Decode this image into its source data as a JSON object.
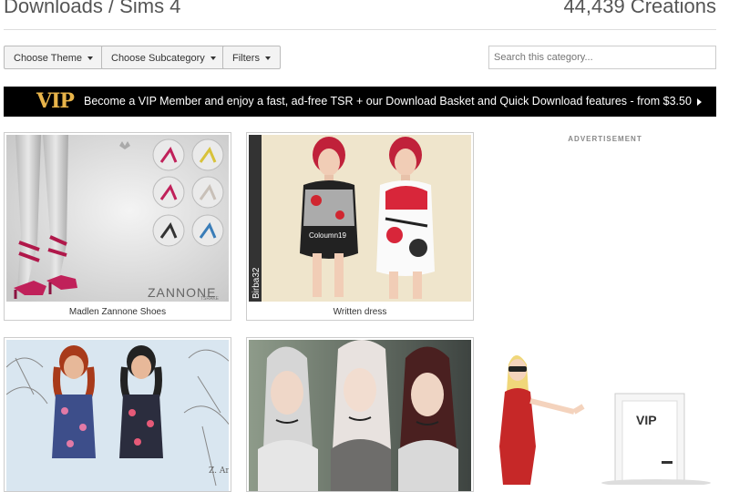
{
  "header": {
    "title": "Downloads / Sims 4",
    "count": "44,439 Creations"
  },
  "filters": {
    "theme_label": "Choose Theme",
    "subcategory_label": "Choose Subcategory",
    "filters_label": "Filters",
    "search_placeholder": "Search this category..."
  },
  "vip_banner": {
    "logo": "VIP",
    "message": "Become a VIP Member and enjoy a fast, ad-free TSR + our Download Basket and Quick Download features - from $3.50"
  },
  "items": [
    {
      "name": "Madlen Zannone Shoes",
      "brand_text": "ZANNONE",
      "watermark": "TSRAKE"
    },
    {
      "name": "Written dress",
      "creator_watermark": "Birba32",
      "shirt_text": "Coloumn19"
    },
    {
      "name": "",
      "watermark": "Z. Art"
    },
    {
      "name": ""
    }
  ],
  "advertisement": {
    "label": "ADVERTISEMENT",
    "door_text": "VIP"
  }
}
